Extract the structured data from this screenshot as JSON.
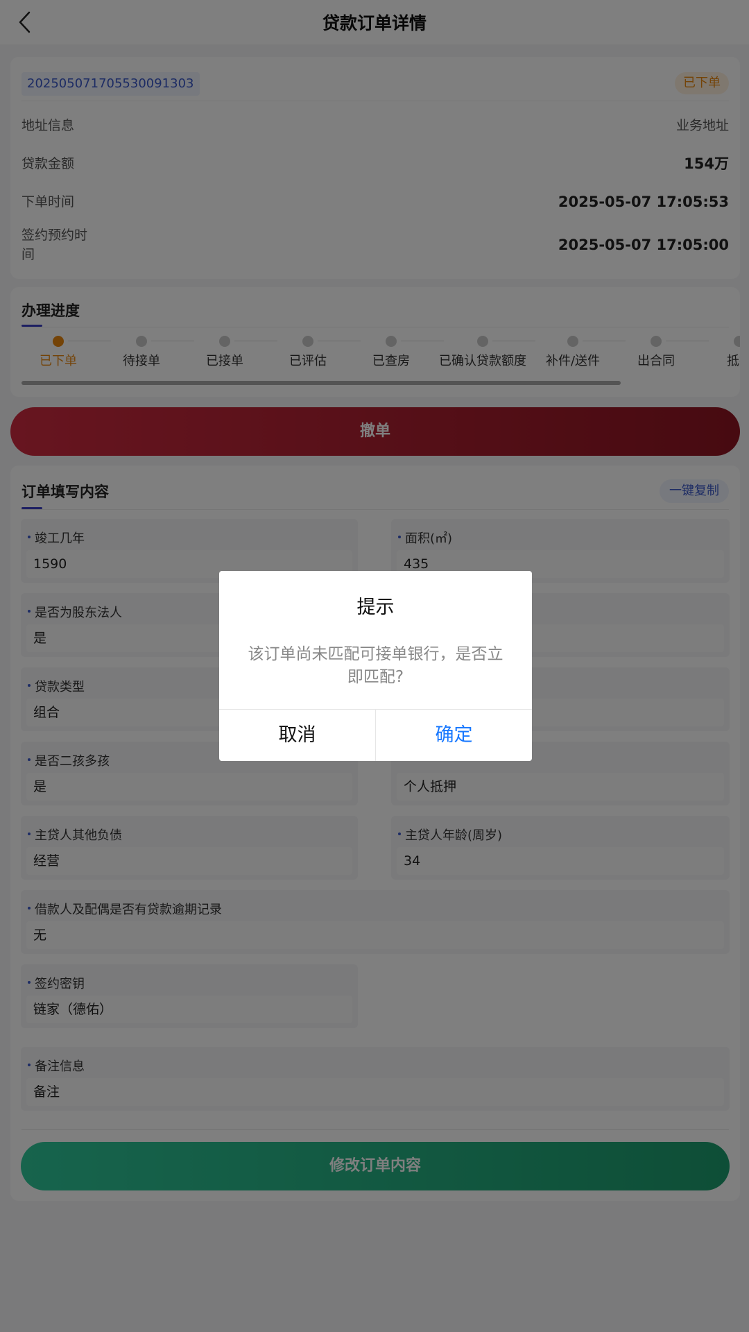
{
  "header": {
    "title": "贷款订单详情"
  },
  "order": {
    "number": "202505071705530091303",
    "status": "已下单",
    "rows": [
      {
        "label": "地址信息",
        "value": "业务地址"
      },
      {
        "label": "贷款金额",
        "value": "154万"
      },
      {
        "label": "下单时间",
        "value": "2025-05-07 17:05:53"
      },
      {
        "label": "签约预约时间",
        "value": "2025-05-07 17:05:00"
      }
    ]
  },
  "progress": {
    "title": "办理进度",
    "steps": [
      "已下单",
      "待接单",
      "已接单",
      "已评估",
      "已查房",
      "已确认贷款额度",
      "补件/送件",
      "出合同",
      "抵押"
    ],
    "current_step": 0
  },
  "cancel_order_label": "撤单",
  "form": {
    "title": "订单填写内容",
    "copy_label": "一键复制",
    "fields": [
      {
        "label": "竣工几年",
        "value": "1590"
      },
      {
        "label": "面积(㎡)",
        "value": "435"
      },
      {
        "label": "是否为股东法人",
        "value": "是"
      },
      {
        "label": "",
        "value": ""
      },
      {
        "label": "贷款类型",
        "value": "组合"
      },
      {
        "label": "",
        "value": ""
      },
      {
        "label": "是否二孩多孩",
        "value": "是"
      },
      {
        "label": "",
        "value": "个人抵押"
      },
      {
        "label": "主贷人其他负债",
        "value": "经营"
      },
      {
        "label": "主贷人年龄(周岁)",
        "value": "34"
      },
      {
        "label": "借款人及配偶是否有贷款逾期记录",
        "value": "无"
      },
      {
        "label": "签约密钥",
        "value": "链家（德佑）"
      },
      {
        "label": "备注信息",
        "value": "备注"
      }
    ],
    "edit_label": "修改订单内容"
  },
  "modal": {
    "title": "提示",
    "message": "该订单尚未匹配可接单银行，是否立即匹配?",
    "cancel_label": "取消",
    "confirm_label": "确定"
  },
  "colors": {
    "accent_blue": "#3a58c9",
    "status_orange": "#e8860e",
    "cancel_red": "#cf2b40",
    "edit_green": "#2ec89a",
    "confirm_blue": "#1677ff"
  }
}
